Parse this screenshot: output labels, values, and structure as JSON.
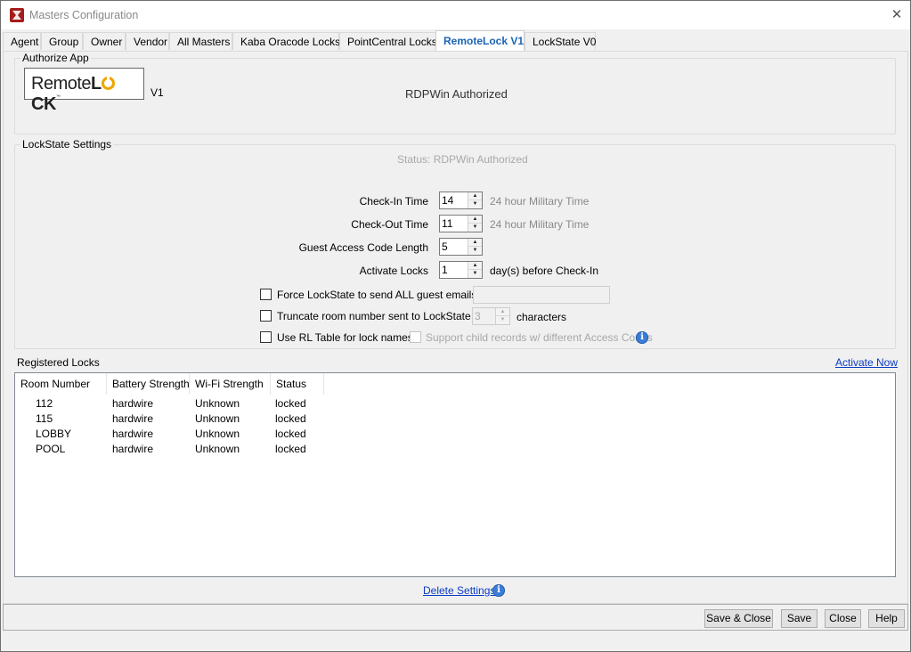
{
  "window": {
    "title": "Masters Configuration",
    "close_glyph": "✕",
    "app_icon": "rdp-app-icon"
  },
  "tabs": [
    {
      "label": "Agent"
    },
    {
      "label": "Group"
    },
    {
      "label": "Owner"
    },
    {
      "label": "Vendor"
    },
    {
      "label": "All Masters"
    },
    {
      "label": "Kaba Oracode Locks"
    },
    {
      "label": "PointCentral Locks"
    },
    {
      "label": "RemoteLock V1",
      "active": true
    },
    {
      "label": "LockState V0"
    }
  ],
  "authorize": {
    "legend": "Authorize App",
    "logo_text_a": "Remote",
    "logo_text_b": "L",
    "logo_text_c": "CK",
    "logo_tm": "™",
    "version": "V1",
    "status": "RDPWin Authorized"
  },
  "lockstate": {
    "legend": "LockState Settings",
    "status": "Status: RDPWin Authorized",
    "checkin": {
      "label": "Check-In Time",
      "value": "14",
      "hint": "24 hour Military Time"
    },
    "checkout": {
      "label": "Check-Out Time",
      "value": "11",
      "hint": "24 hour Military Time"
    },
    "code_length": {
      "label": "Guest Access Code Length",
      "value": "5"
    },
    "activate": {
      "label": "Activate Locks",
      "value": "1",
      "suffix": "day(s) before Check-In"
    },
    "force_emails": {
      "label": "Force LockState to send ALL guest emails to:",
      "checked": false,
      "value": ""
    },
    "truncate": {
      "label": "Truncate room number sent to LockState to:",
      "checked": false,
      "value": "3",
      "suffix": "characters"
    },
    "rl_table": {
      "label": "Use RL Table for lock names",
      "checked": false
    },
    "child_records": {
      "label": "Support child records w/ different Access Codes",
      "checked": false,
      "enabled": false
    }
  },
  "registered": {
    "label": "Registered Locks",
    "activate_link": "Activate Now",
    "columns": [
      "Room Number",
      "Battery Strength",
      "Wi-Fi Strength",
      "Status"
    ],
    "rows": [
      [
        "112",
        "hardwire",
        "Unknown",
        "locked"
      ],
      [
        "115",
        "hardwire",
        "Unknown",
        "locked"
      ],
      [
        "LOBBY",
        "hardwire",
        "Unknown",
        "locked"
      ],
      [
        "POOL",
        "hardwire",
        "Unknown",
        "locked"
      ]
    ]
  },
  "delete_link": "Delete Settings",
  "info_glyph": "i",
  "spin_up": "▲",
  "spin_down": "▼",
  "buttons": {
    "save_close": "Save & Close",
    "save": "Save",
    "close": "Close",
    "help": "Help"
  }
}
